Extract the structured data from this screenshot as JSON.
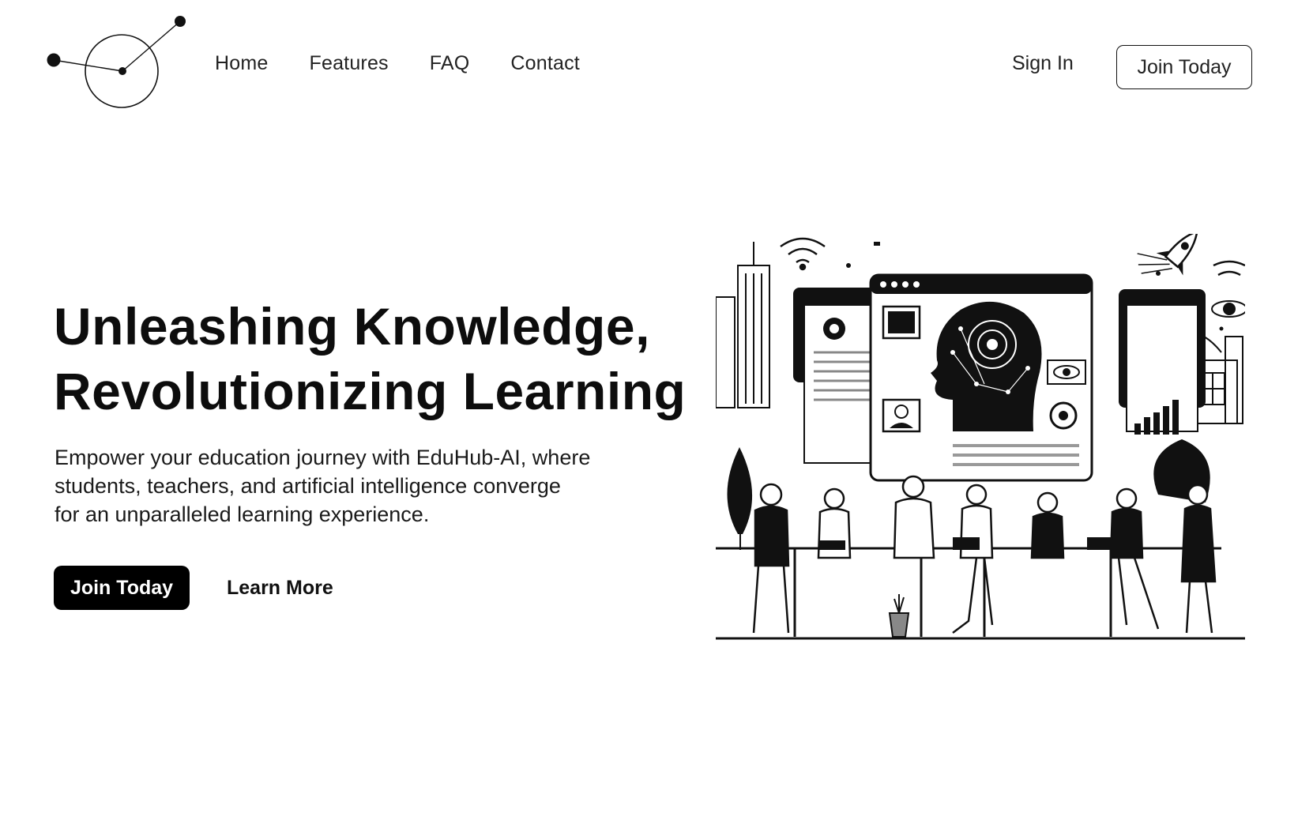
{
  "header": {
    "nav": [
      "Home",
      "Features",
      "FAQ",
      "Contact"
    ],
    "sign_in": "Sign In",
    "join_today": "Join Today"
  },
  "hero": {
    "title_lines": [
      "Unleashing Knowledge,",
      "Revolutionizing Learning"
    ],
    "subtitle_lines": [
      "Empower your education journey with EduHub-AI, where",
      "students, teachers, and artificial intelligence converge",
      "for an unparalleled learning experience."
    ],
    "primary_button": "Join Today",
    "secondary_button": "Learn More"
  },
  "icons": {
    "logo": "constellation-logo-icon",
    "illustration": "ai-classroom-illustration"
  },
  "colors": {
    "background": "#ffffff",
    "text": "#111111",
    "primary_button_bg": "#000000",
    "primary_button_text": "#ffffff"
  }
}
